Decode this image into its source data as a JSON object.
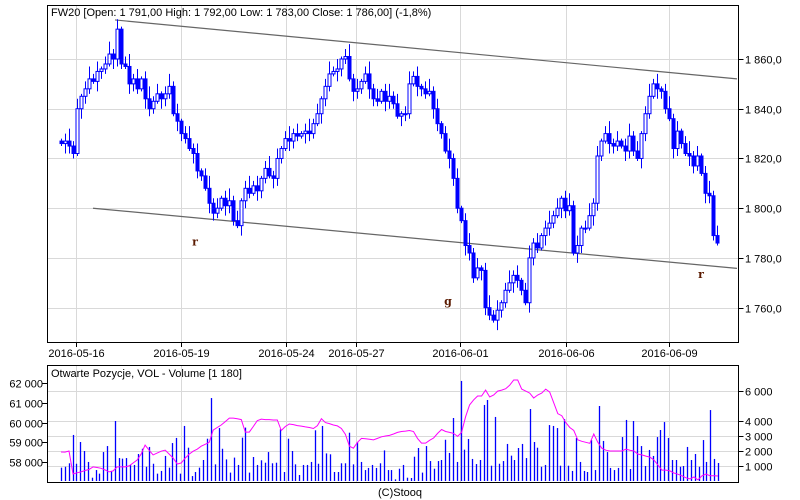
{
  "chart_data": [
    {
      "type": "candlestick",
      "title": "FW20 [Open: 1 791,00  High: 1 792,00  Low: 1 783,00  Close: 1 786,00] (-1,8%)",
      "ylim": [
        1746,
        1881
      ],
      "y_ticks": [
        1760,
        1780,
        1800,
        1820,
        1840,
        1860
      ],
      "y_tick_labels": [
        "1 760,0",
        "1 780,0",
        "1 800,0",
        "1 820,0",
        "1 840,0",
        "1 860,0"
      ],
      "x_tick_labels": [
        "2016-05-16",
        "2016-05-19",
        "2016-05-24",
        "2016-05-27",
        "2016-06-01",
        "2016-06-06",
        "2016-06-09"
      ],
      "x_tick_candle_index": [
        3.75,
        30,
        56.25,
        73.75,
        99.75,
        126.25,
        152
      ],
      "grid": true,
      "closes": [
        1826,
        1827,
        1825,
        1822,
        1840,
        1845,
        1848,
        1852,
        1851,
        1855,
        1856,
        1858,
        1862,
        1860,
        1872,
        1858,
        1857,
        1850,
        1852,
        1848,
        1852,
        1844,
        1840,
        1843,
        1846,
        1844,
        1846,
        1849,
        1838,
        1835,
        1830,
        1828,
        1824,
        1822,
        1815,
        1813,
        1808,
        1802,
        1798,
        1800,
        1804,
        1801,
        1803,
        1795,
        1793,
        1803,
        1808,
        1806,
        1809,
        1807,
        1812,
        1816,
        1813,
        1812,
        1820,
        1824,
        1828,
        1827,
        1830,
        1829,
        1830,
        1831,
        1830,
        1834,
        1838,
        1844,
        1849,
        1854,
        1855,
        1856,
        1860,
        1861,
        1852,
        1847,
        1848,
        1851,
        1854,
        1848,
        1844,
        1843,
        1847,
        1843,
        1845,
        1842,
        1837,
        1838,
        1838,
        1850,
        1853,
        1849,
        1848,
        1846,
        1847,
        1840,
        1834,
        1830,
        1823,
        1820,
        1812,
        1800,
        1795,
        1785,
        1782,
        1772,
        1776,
        1775,
        1760,
        1757,
        1755,
        1759,
        1762,
        1767,
        1770,
        1773,
        1771,
        1767,
        1762,
        1780,
        1786,
        1784,
        1789,
        1792,
        1794,
        1797,
        1800,
        1804,
        1799,
        1801,
        1782,
        1785,
        1792,
        1792,
        1797,
        1802,
        1821,
        1827,
        1830,
        1826,
        1825,
        1827,
        1825,
        1823,
        1829,
        1823,
        1820,
        1830,
        1838,
        1845,
        1850,
        1848,
        1847,
        1840,
        1836,
        1824,
        1831,
        1826,
        1822,
        1821,
        1817,
        1821,
        1814,
        1806,
        1805,
        1789,
        1786
      ],
      "trend_lines": [
        {
          "name": "upper-channel",
          "from": [
            13.5,
            1875.7
          ],
          "to": [
            169,
            1852
          ]
        },
        {
          "name": "lower-channel",
          "from": [
            8,
            1800
          ],
          "to": [
            169,
            1775.8
          ]
        }
      ],
      "annotations": [
        {
          "text": "r",
          "index": 33.5,
          "price": 1785
        },
        {
          "text": "g",
          "index": 96.75,
          "price": 1761
        },
        {
          "text": "r",
          "index": 160,
          "price": 1772
        }
      ],
      "colors": {
        "candle": "#0000ff",
        "grid": "#d9d9d9",
        "trend": "#666666"
      }
    },
    {
      "type": "bar+line",
      "title": "Otwarte Pozycje, VOL - Volume [1 180]",
      "left_axis": {
        "label": "Otwarte Pozycje",
        "ticks": [
          58000,
          59000,
          60000,
          61000,
          62000
        ],
        "tick_labels": [
          "58 000",
          "59 000",
          "60 000",
          "61 000",
          "62 000"
        ]
      },
      "right_axis": {
        "label": "Volume",
        "ticks": [
          1000,
          2000,
          3000,
          4000,
          6000
        ],
        "tick_labels": [
          "1 000",
          "2 000",
          "3 000",
          "4 000",
          "6 000"
        ]
      },
      "volume": [
        890,
        950,
        1180,
        3070,
        1150,
        2600,
        2000,
        1270,
        220,
        730,
        490,
        1930,
        2330,
        670,
        4000,
        1530,
        1490,
        1530,
        1070,
        1070,
        1800,
        2150,
        950,
        2270,
        1150,
        490,
        670,
        1670,
        890,
        2530,
        2870,
        490,
        3670,
        2220,
        330,
        600,
        890,
        1400,
        2820,
        5530,
        1110,
        3530,
        2150,
        1440,
        560,
        1560,
        1070,
        2890,
        3560,
        560,
        1600,
        1070,
        1380,
        1220,
        1930,
        1180,
        1220,
        3440,
        600,
        2820,
        2000,
        1110,
        400,
        1070,
        1070,
        1270,
        3380,
        1150,
        3670,
        1840,
        1780,
        600,
        600,
        1180,
        1180,
        3220,
        1110,
        2600,
        1270,
        730,
        870,
        1070,
        870,
        1180,
        2040,
        730,
        730,
        110,
        820,
        1070,
        220,
        200,
        1620,
        2200,
        560,
        2330,
        1330,
        820,
        1330,
        1400,
        2750,
        1870,
        4200,
        1270,
        6670,
        2090,
        2800,
        1470,
        1130,
        1400,
        5070,
        5400,
        1020,
        4270,
        1150,
        1330,
        2470,
        1690,
        1400,
        2200,
        2470,
        1530,
        4800,
        2600,
        2220,
        950,
        1070,
        3730,
        3670,
        3530,
        1020,
        4130,
        1020,
        670,
        2870,
        1270,
        670,
        600,
        2730,
        730,
        5000,
        2670,
        1930,
        870,
        730,
        870,
        2930,
        4070,
        800,
        4000,
        3000,
        2330,
        1000,
        2070,
        1670,
        2930,
        3400,
        3930,
        2870,
        1400,
        1400,
        950,
        1000,
        2270,
        1400,
        1800,
        950,
        2730,
        1270,
        4730,
        1470,
        1200
      ],
      "open_interest": [
        58510,
        58500,
        58560,
        57390,
        57450,
        57500,
        57570,
        57620,
        57750,
        57720,
        57680,
        57600,
        57500,
        57550,
        57750,
        57750,
        57750,
        57800,
        57950,
        58100,
        58400,
        58860,
        58600,
        58360,
        58450,
        58550,
        58600,
        58400,
        58200,
        57900,
        57950,
        58200,
        58400,
        58550,
        58650,
        58800,
        58900,
        59000,
        59620,
        59750,
        59880,
        60050,
        60230,
        60230,
        60200,
        60150,
        59520,
        59520,
        59800,
        60100,
        60180,
        60150,
        60150,
        60130,
        60130,
        59600,
        59800,
        59930,
        59900,
        59850,
        59820,
        59780,
        59750,
        59700,
        59850,
        60200,
        60000,
        59950,
        59880,
        59830,
        59700,
        59400,
        58800,
        58700,
        59000,
        59200,
        59180,
        59150,
        59120,
        59200,
        59280,
        59320,
        59350,
        59420,
        59500,
        59550,
        59570,
        59600,
        59550,
        59200,
        58960,
        58960,
        59100,
        59220,
        59450,
        59650,
        59550,
        59500,
        59450,
        59300,
        59500,
        60300,
        60900,
        61150,
        61350,
        61350,
        61650,
        61300,
        61400,
        61600,
        61650,
        61720,
        61900,
        62160,
        62160,
        61700,
        61600,
        61500,
        61250,
        61400,
        61500,
        61700,
        61550,
        61000,
        60450,
        60350,
        60000,
        59750,
        59600,
        59120,
        59050,
        59000,
        58950,
        59420,
        59000,
        58700,
        58600,
        58560,
        58560,
        58560,
        58560,
        58650,
        58600,
        58560,
        58400,
        58360,
        58300,
        58250,
        58100,
        57850,
        57590,
        57590,
        57550,
        57440,
        57380,
        57300,
        57200,
        57140,
        57240,
        57090,
        57300,
        57390,
        57300,
        57300,
        57290
      ],
      "colors": {
        "volume": "#0000ff",
        "open_interest": "#ff00ff"
      }
    }
  ],
  "footer": {
    "credit": "(C)Stooq"
  }
}
